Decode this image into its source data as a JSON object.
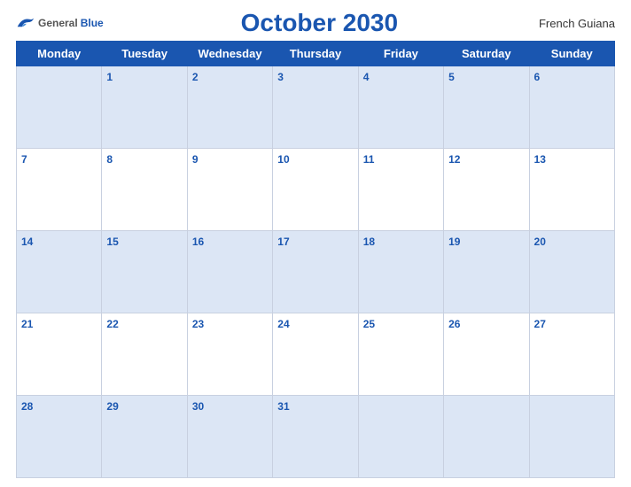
{
  "header": {
    "logo_general": "General",
    "logo_blue": "Blue",
    "title": "October 2030",
    "region": "French Guiana"
  },
  "weekdays": [
    "Monday",
    "Tuesday",
    "Wednesday",
    "Thursday",
    "Friday",
    "Saturday",
    "Sunday"
  ],
  "weeks": [
    [
      "",
      "1",
      "2",
      "3",
      "4",
      "5",
      "6"
    ],
    [
      "7",
      "8",
      "9",
      "10",
      "11",
      "12",
      "13"
    ],
    [
      "14",
      "15",
      "16",
      "17",
      "18",
      "19",
      "20"
    ],
    [
      "21",
      "22",
      "23",
      "24",
      "25",
      "26",
      "27"
    ],
    [
      "28",
      "29",
      "30",
      "31",
      "",
      "",
      ""
    ]
  ]
}
